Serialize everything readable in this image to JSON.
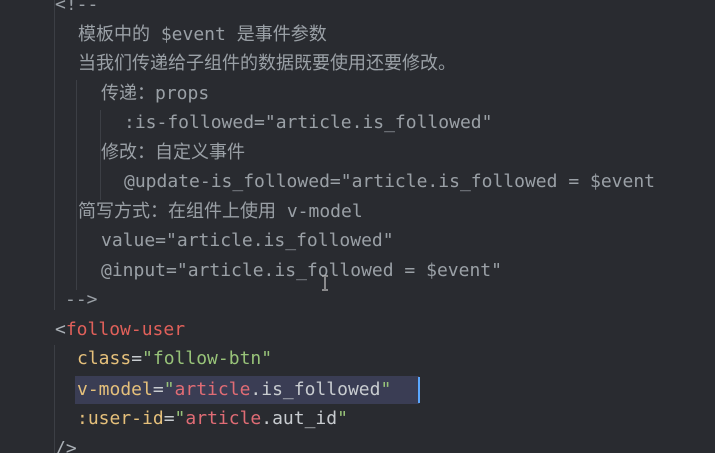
{
  "editor": {
    "lines": [
      {
        "text": "<!--"
      },
      {
        "text": "模板中的 $event 是事件参数"
      },
      {
        "text": "当我们传递给子组件的数据既要使用还要修改。"
      },
      {
        "text": "传递：props"
      },
      {
        "text": ":is-followed=\"article.is_followed\""
      },
      {
        "text": "修改：自定义事件"
      },
      {
        "text": "@update-is_followed=\"article.is_followed = $event"
      },
      {
        "text": "简写方式：在组件上使用 v-model"
      },
      {
        "text": "value=\"article.is_followed\""
      },
      {
        "text": "@input=\"article.is_followed = $event\""
      },
      {
        "text": "-->"
      }
    ],
    "tag_open": "<",
    "tag_name": "follow-user",
    "attrs": [
      {
        "name": "class",
        "eq": "=",
        "q1": "\"",
        "value": "follow-btn",
        "q2": "\""
      },
      {
        "name": "v-model",
        "eq": "=",
        "q1": "\"",
        "value": "article",
        "dot": ".is_followed",
        "q2": "\""
      },
      {
        "name": ":user-id",
        "eq": "=",
        "q1": "\"",
        "value": "article",
        "dot": ".aut_id",
        "q2": "\""
      }
    ],
    "tag_close": "/>"
  },
  "colors": {
    "background": "#292b30",
    "comment": "#9aa0a6",
    "tag": "#e0605a",
    "attr": "#e5c07b",
    "string": "#98c379",
    "selection": "#3a3d54",
    "caret": "#5aa7ff"
  },
  "icons": {
    "cursor": "i-beam-cursor-icon"
  }
}
